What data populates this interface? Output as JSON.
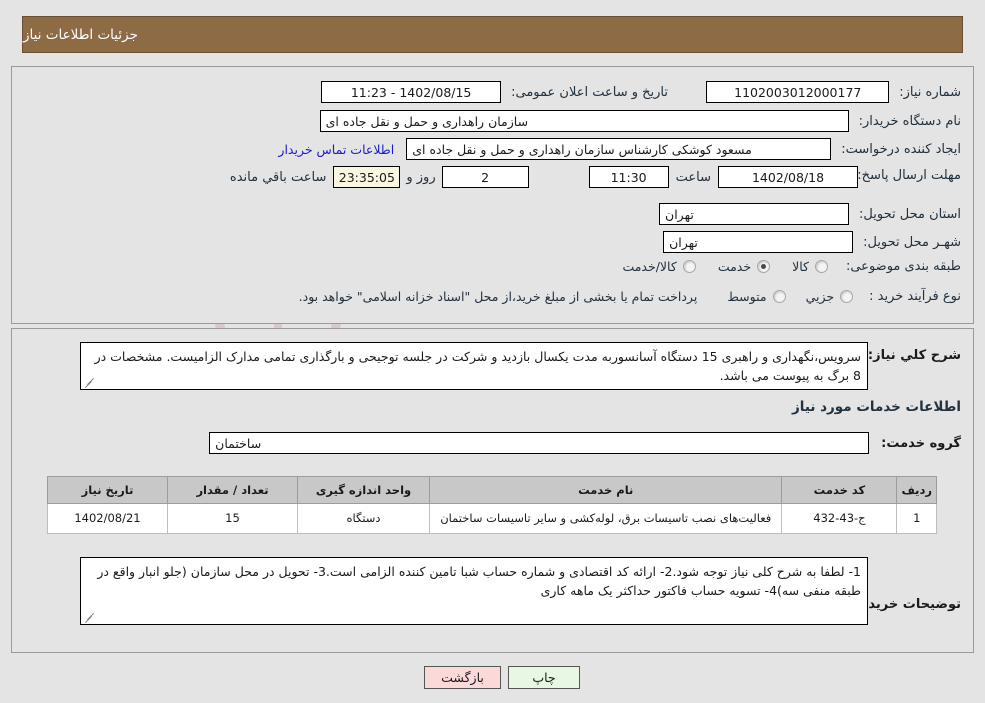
{
  "header": {
    "title": "جزئیات اطلاعات نیاز"
  },
  "watermark": {
    "text_a": "Arta",
    "text_b": "Tender",
    "text_c": ".net"
  },
  "form": {
    "need_number": {
      "label": "شماره نیاز:",
      "value": "1102003012000177"
    },
    "public_announce": {
      "label": "تاریخ و ساعت اعلان عمومی:",
      "value": "1402/08/15 - 11:23"
    },
    "buyer_org": {
      "label": "نام دستگاه خریدار:",
      "value": "سازمان راهداری و حمل و نقل جاده ای"
    },
    "request_creator": {
      "label": "ایجاد کننده درخواست:",
      "value": "مسعود کوشکی کارشناس  سازمان راهداری و حمل و نقل جاده ای"
    },
    "buyer_contact_link": "اطلاعات تماس خریدار",
    "deadline": {
      "label": "مهلت ارسال پاسخ: تا تاریخ:",
      "date": "1402/08/18",
      "hour_label": "ساعت",
      "hour": "11:30",
      "days": "2",
      "days_label": "روز و",
      "countdown": "23:35:05",
      "remaining_label": "ساعت باقي مانده"
    },
    "province": {
      "label": "استان محل تحویل:",
      "value": "تهران"
    },
    "city": {
      "label": "شهـر محل تحویل:",
      "value": "تهران"
    },
    "category": {
      "label": "طبقه بندی موضوعی:",
      "options": [
        {
          "label": "کالا",
          "selected": false
        },
        {
          "label": "خدمت",
          "selected": true
        },
        {
          "label": "کالا/خدمت",
          "selected": false
        }
      ]
    },
    "purchase_type": {
      "label": "نوع فرآیند خرید :",
      "options": [
        {
          "label": "جزیي",
          "selected": false
        },
        {
          "label": "متوسط",
          "selected": false
        }
      ],
      "note": "پرداخت تمام یا بخشی از مبلغ خرید،از محل \"اسناد خزانه اسلامی\" خواهد بود."
    },
    "general_description": {
      "label": "شرح کلي نیاز:",
      "value": "سرویس،نگهداری و راهبری 15 دستگاه آسانسوربه مدت یکسال بازدید و شرکت در جلسه توجیحی و بارگذاری تمامی مدارک الزامیست. مشخصات در 8 برگ به پیوست می باشد."
    },
    "services_section_heading": "اطلاعات خدمات مورد نیاز",
    "service_group": {
      "label": "گروه خدمت:",
      "value": "ساختمان"
    },
    "buyer_notes": {
      "label": "توضیحات خریدار:",
      "value": "1- لطفا به شرح کلی نیاز توجه شود.2- ارائه کد اقتصادی و شماره حساب شبا تامین کننده الزامی است.3- تحویل در محل سازمان (جلو انبار واقع در طبقه منفی سه)4- تسویه حساب فاکتور حداکثر یک ماهه کاری"
    }
  },
  "table": {
    "columns": [
      "ردیف",
      "کد خدمت",
      "نام خدمت",
      "واحد اندازه گیری",
      "تعداد / مقدار",
      "تاریخ نیاز"
    ],
    "rows": [
      {
        "index": "1",
        "code": "ج-43-432",
        "name": "فعالیت‌های نصب تاسیسات برق، لوله‌کشی و سایر تاسیسات ساختمان",
        "unit": "دستگاه",
        "qty": "15",
        "date": "1402/08/21"
      }
    ]
  },
  "buttons": {
    "print": "چاپ",
    "back": "بازگشت"
  }
}
